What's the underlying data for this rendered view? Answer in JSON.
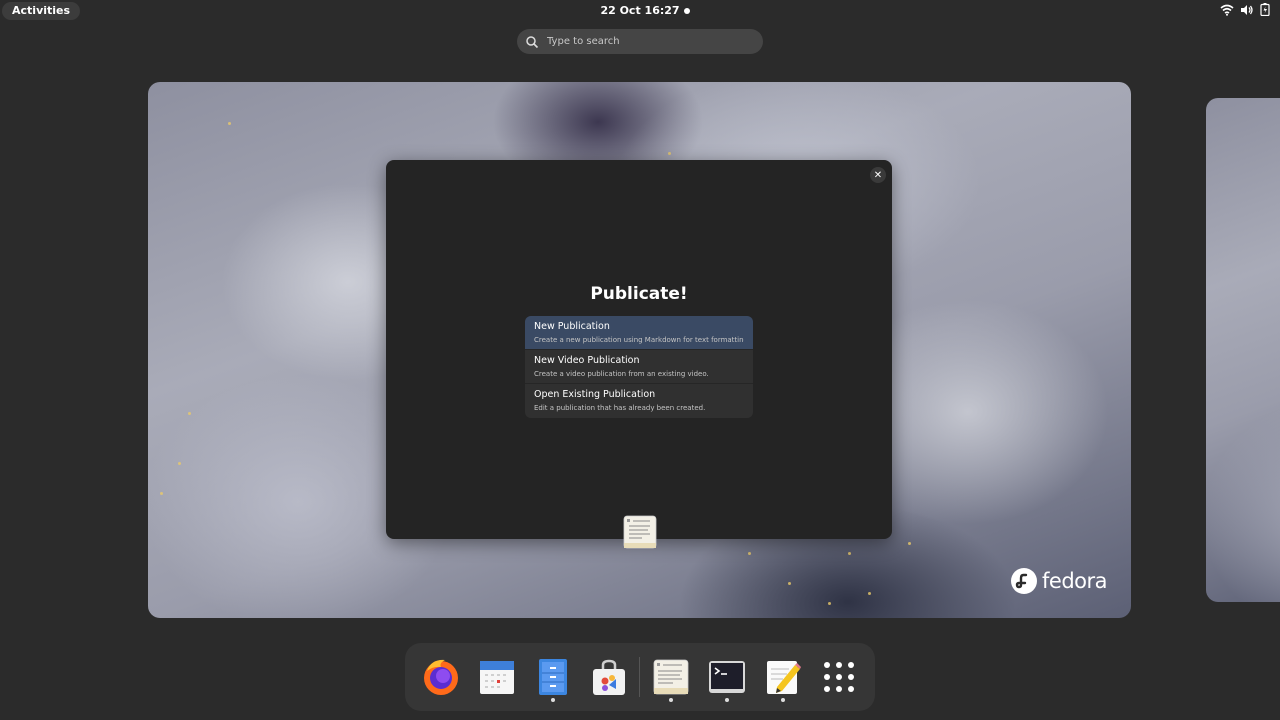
{
  "topbar": {
    "activities_label": "Activities",
    "clock": "22 Oct  16:27"
  },
  "search": {
    "placeholder": "Type to search"
  },
  "window": {
    "title": "Publicate!",
    "options": [
      {
        "title": "New Publication",
        "description": "Create a new publication using Markdown for text formatting.",
        "selected": true
      },
      {
        "title": "New Video Publication",
        "description": "Create a video publication from an existing video.",
        "selected": false
      },
      {
        "title": "Open Existing Publication",
        "description": "Edit a publication that has already been created.",
        "selected": false
      }
    ],
    "close_glyph": "✕"
  },
  "wallpaper": {
    "logo_text": "fedora"
  },
  "dash": {
    "apps": [
      {
        "name": "firefox-icon",
        "running": false
      },
      {
        "name": "calendar-icon",
        "running": false
      },
      {
        "name": "files-icon",
        "running": true
      },
      {
        "name": "software-icon",
        "running": false
      },
      {
        "name": "publicate-icon",
        "running": true
      },
      {
        "name": "terminal-icon",
        "running": true
      },
      {
        "name": "text-editor-icon",
        "running": true
      },
      {
        "name": "app-grid-icon",
        "running": false
      }
    ]
  },
  "colors": {
    "accent": "#3a4a64",
    "panel": "#2b2b2b",
    "window": "#242424"
  }
}
